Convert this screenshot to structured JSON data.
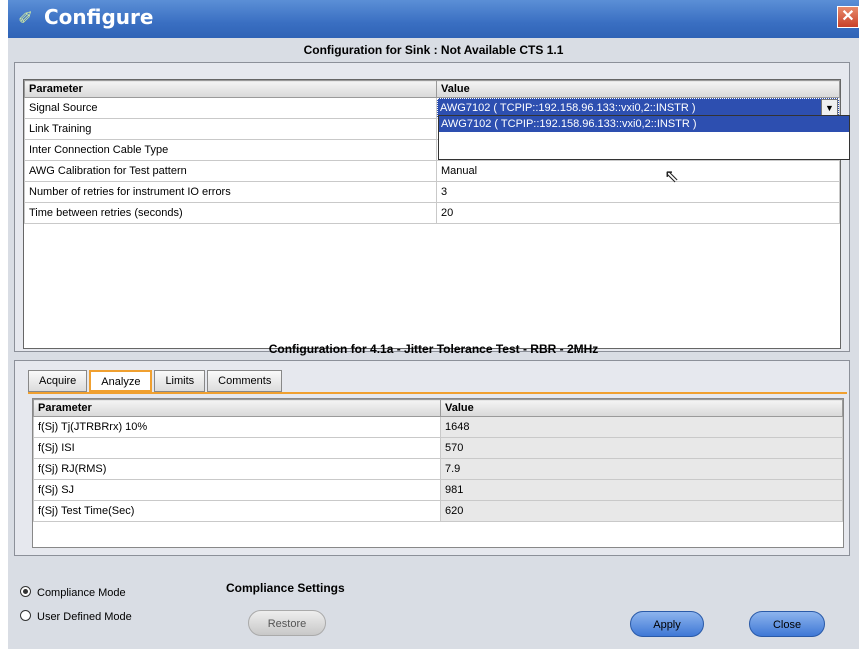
{
  "window": {
    "title": "Configure",
    "close_glyph": "✕",
    "app_icon": "configure-icon"
  },
  "sink": {
    "title": "Configuration for Sink : Not Available CTS 1.1",
    "headers": [
      "Parameter",
      "Value"
    ],
    "rows": [
      {
        "param": "Signal Source",
        "value": "AWG7102 ( TCPIP::192.158.96.133::vxi0,2::INSTR )"
      },
      {
        "param": "Link Training",
        "value": ""
      },
      {
        "param": "Inter Connection Cable Type",
        "value": ""
      },
      {
        "param": "AWG Calibration for Test pattern",
        "value": "Manual"
      },
      {
        "param": "Number of retries for instrument IO errors",
        "value": "3"
      },
      {
        "param": "Time between retries (seconds)",
        "value": "20"
      }
    ],
    "dropdown_option": "AWG7102 ( TCPIP::192.158.96.133::vxi0,2::INSTR )"
  },
  "test": {
    "title": "Configuration for 4.1a - Jitter Tolerance Test - RBR - 2MHz",
    "tabs": [
      "Acquire",
      "Analyze",
      "Limits",
      "Comments"
    ],
    "active_tab": "Analyze",
    "headers": [
      "Parameter",
      "Value"
    ],
    "rows": [
      {
        "param": "f(Sj) Tj(JTRBRrx) 10%",
        "value": "1648"
      },
      {
        "param": "f(Sj) ISI",
        "value": "570"
      },
      {
        "param": "f(Sj) RJ(RMS)",
        "value": "7.9"
      },
      {
        "param": "f(Sj) SJ",
        "value": "981"
      },
      {
        "param": "f(Sj) Test Time(Sec)",
        "value": "620"
      }
    ]
  },
  "mode": {
    "compliance": "Compliance Mode",
    "user_defined": "User Defined Mode",
    "selected": "Compliance Mode"
  },
  "settings": {
    "title": "Compliance Settings",
    "restore": "Restore"
  },
  "buttons": {
    "apply": "Apply",
    "close": "Close"
  }
}
